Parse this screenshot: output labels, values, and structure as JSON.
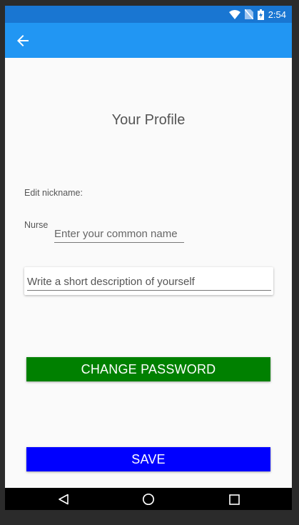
{
  "status_bar": {
    "time": "2:54",
    "icons": [
      "wifi-icon",
      "no-sim-icon",
      "battery-charging-icon"
    ]
  },
  "app_bar": {
    "back_icon": "arrow-back-icon",
    "color": "#2196f3"
  },
  "profile": {
    "title": "Your Profile",
    "edit_nickname_label": "Edit nickname:",
    "role_label": "Nurse",
    "nickname_placeholder": "Enter your common name",
    "description_placeholder": "Write a short description of yourself"
  },
  "buttons": {
    "change_password": "CHANGE PASSWORD",
    "change_password_color": "#008000",
    "save": "SAVE",
    "save_color": "#0000ff"
  },
  "nav_bar": {
    "icons": [
      "back-triangle-icon",
      "home-circle-icon",
      "recents-square-icon"
    ]
  }
}
